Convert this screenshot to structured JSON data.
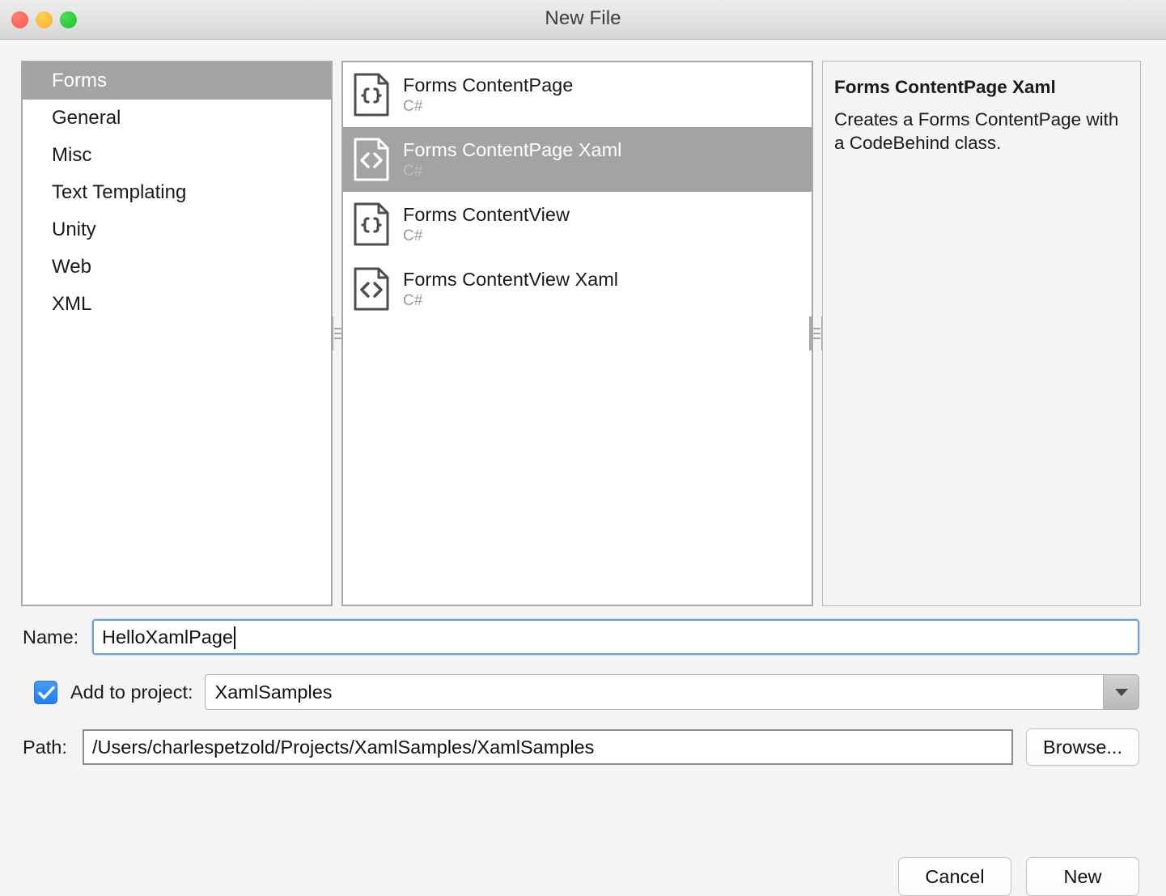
{
  "window": {
    "title": "New File",
    "traffic_lights": [
      {
        "name": "close",
        "color": "#f9584f"
      },
      {
        "name": "minimize",
        "color": "#f5b32c"
      },
      {
        "name": "zoom",
        "color": "#20c32e"
      }
    ]
  },
  "categories": {
    "selected": "Forms",
    "items": [
      {
        "label": "Forms",
        "selected": true
      },
      {
        "label": "General",
        "selected": false
      },
      {
        "label": "Misc",
        "selected": false
      },
      {
        "label": "Text Templating",
        "selected": false
      },
      {
        "label": "Unity",
        "selected": false
      },
      {
        "label": "Web",
        "selected": false
      },
      {
        "label": "XML",
        "selected": false
      }
    ]
  },
  "templates": {
    "items": [
      {
        "title": "Forms ContentPage",
        "language": "C#",
        "icon": "braces-document-icon",
        "selected": false
      },
      {
        "title": "Forms ContentPage Xaml",
        "language": "C#",
        "icon": "angle-brackets-document-icon",
        "selected": true
      },
      {
        "title": "Forms ContentView",
        "language": "C#",
        "icon": "braces-document-icon",
        "selected": false
      },
      {
        "title": "Forms ContentView Xaml",
        "language": "C#",
        "icon": "angle-brackets-document-icon",
        "selected": false
      }
    ]
  },
  "description": {
    "title": "Forms ContentPage Xaml",
    "body": "Creates a Forms ContentPage with a CodeBehind class."
  },
  "form": {
    "name": {
      "label": "Name:",
      "value": "HelloXamlPage"
    },
    "add_to_project": {
      "label": "Add to project:",
      "checked": true,
      "value": "XamlSamples"
    },
    "path": {
      "label": "Path:",
      "value": "/Users/charlespetzold/Projects/XamlSamples/XamlSamples",
      "browse_label": "Browse..."
    }
  },
  "footer": {
    "cancel_label": "Cancel",
    "new_label": "New"
  },
  "colors": {
    "selection": "#a3a3a3",
    "accent": "#1e7ff0",
    "focus_border": "#6e9fe0",
    "panel_border": "#a8a8a8",
    "window_bg": "#f4f4f4"
  }
}
